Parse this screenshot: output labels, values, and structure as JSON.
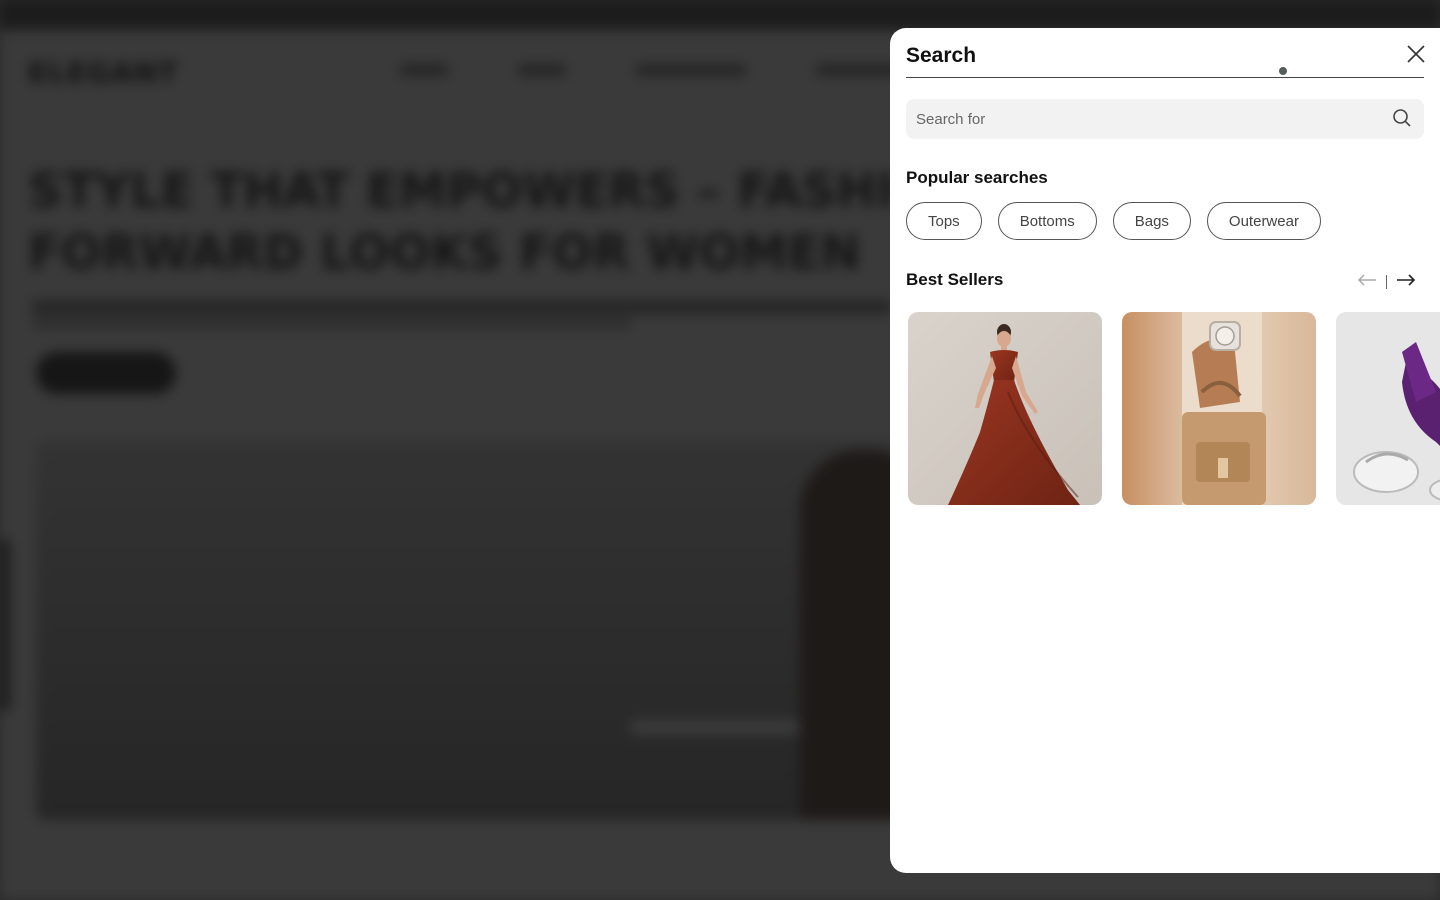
{
  "background_page": {
    "logo": "ELEGANT",
    "hero_title": "STYLE THAT EMPOWERS – FASHION-FORWARD LOOKS FOR WOMEN"
  },
  "search_panel": {
    "title": "Search",
    "close_icon": "close-icon",
    "search": {
      "placeholder": "Search for",
      "value": "",
      "icon": "search-icon"
    },
    "popular": {
      "title": "Popular searches",
      "chips": [
        "Tops",
        "Bottoms",
        "Bags",
        "Outerwear"
      ]
    },
    "best_sellers": {
      "title": "Best Sellers",
      "prev_icon": "arrow-left-icon",
      "next_icon": "arrow-right-icon",
      "products": [
        {
          "alt": "Woman in rust velvet gown",
          "accent": "#8a2e1c"
        },
        {
          "alt": "Hand with watch holding tan handbag",
          "accent": "#c4976a"
        },
        {
          "alt": "Purple trousers with white sneakers",
          "accent": "#5a2170"
        }
      ]
    }
  },
  "colors": {
    "overlay": "#2a2a2a",
    "panel": "#ffffff",
    "search_box": "#f2f2f2",
    "chip_border": "#555555"
  }
}
